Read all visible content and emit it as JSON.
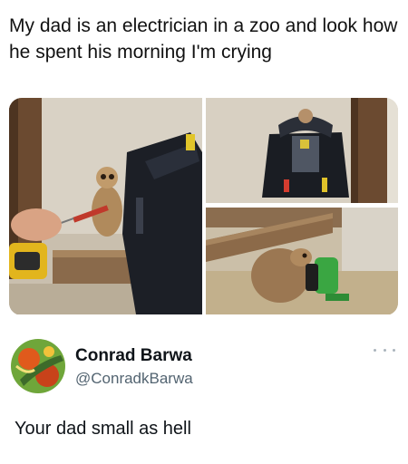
{
  "post": {
    "caption": "My dad is an electrician in a zoo and look how he spent his morning I'm crying"
  },
  "photos": [
    {
      "icon": "meerkat-with-screwdriver-photo"
    },
    {
      "icon": "open-tool-bag-photo"
    },
    {
      "icon": "meerkat-with-green-tool-photo"
    }
  ],
  "reply": {
    "display_name": "Conrad Barwa",
    "handle": "@ConradkBarwa",
    "text": "Your dad small as hell",
    "more_icon": "more-horizontal-icon"
  }
}
